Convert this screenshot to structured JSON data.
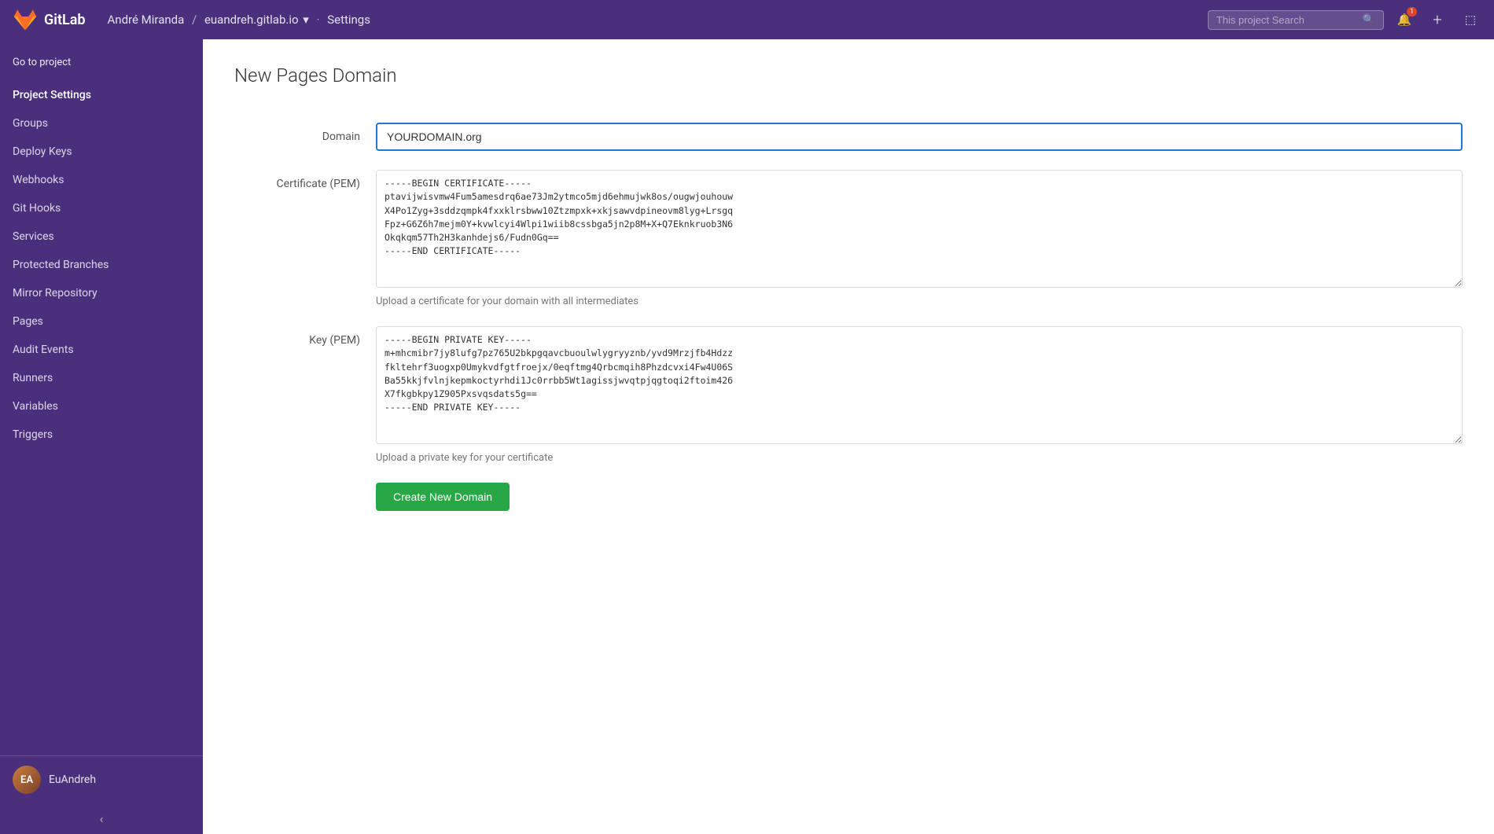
{
  "topnav": {
    "brand": "GitLab",
    "breadcrumb": {
      "user": "André Miranda",
      "separator1": "/",
      "project": "euandreh.gitlab.io",
      "dropdown_icon": "▾",
      "separator2": "·",
      "page": "Settings"
    },
    "search_placeholder": "This project Search",
    "badge_count": "1",
    "icons": {
      "search": "🔍",
      "notification": "🔔",
      "plus": "+",
      "exit": "⬛"
    }
  },
  "sidebar": {
    "go_to_project": "Go to project",
    "items": [
      {
        "label": "Project Settings",
        "icon": "⚙"
      },
      {
        "label": "Groups",
        "icon": "👥"
      },
      {
        "label": "Deploy Keys",
        "icon": "🔑"
      },
      {
        "label": "Webhooks",
        "icon": "🔗"
      },
      {
        "label": "Git Hooks",
        "icon": "📌"
      },
      {
        "label": "Services",
        "icon": "⚡"
      },
      {
        "label": "Protected Branches",
        "icon": "🔒"
      },
      {
        "label": "Mirror Repository",
        "icon": "🔄"
      },
      {
        "label": "Pages",
        "icon": "📄"
      },
      {
        "label": "Audit Events",
        "icon": "📋"
      },
      {
        "label": "Runners",
        "icon": "▶"
      },
      {
        "label": "Variables",
        "icon": "📦"
      },
      {
        "label": "Triggers",
        "icon": "⚡"
      }
    ],
    "user": {
      "name": "EuAndreh",
      "avatar_initials": "EA"
    },
    "collapse_icon": "‹"
  },
  "main": {
    "page_title": "New Pages Domain",
    "form": {
      "domain_label": "Domain",
      "domain_placeholder": "YOURDOMAIN.org",
      "domain_value": "YOURDOMAIN.org",
      "certificate_label": "Certificate (PEM)",
      "certificate_value": "-----BEGIN CERTIFICATE-----\nptavijwisvmw4Fum5amesdrq6ae73Jm2ytmco5mjd6ehmujwk8os/ougwjouhouw\nX4Po1Zyg+3sddzqmpk4fxxklrsbww10Ztzmpxk+xkjsawvdpineovm8lyg+Lrsgq\nFpz+G6Z6h7mejm0Y+kvwlcyi4Wlpi1wiib8cssbga5jn2p8M+X+Q7Eknkruob3N6\nOkqkqm57Th2H3kanhdejs6/Fudn0Gq==\n-----END CERTIFICATE-----",
      "certificate_help": "Upload a certificate for your domain with all intermediates",
      "key_label": "Key (PEM)",
      "key_value": "-----BEGIN PRIVATE KEY-----\nm+mhcmibr7jy8lufg7pz765U2bkpgqavcbuoulwlygryyznb/yvd9Mrzjfb4Hdzz\nfkltehrf3uogxp0Umykvdfgtfroejx/0eqftmg4Qrbcmqih8Phzdcvxi4Fw4U06S\nBa55kkjfvlnjkepmkoctyrhdi1Jc0rrbb5Wt1agissjwvqtpjqgtoqi2ftoim426\nX7fkgbkpy1Z905Pxsvqsdats5g==\n-----END PRIVATE KEY-----",
      "key_help": "Upload a private key for your certificate",
      "submit_label": "Create New Domain"
    }
  }
}
